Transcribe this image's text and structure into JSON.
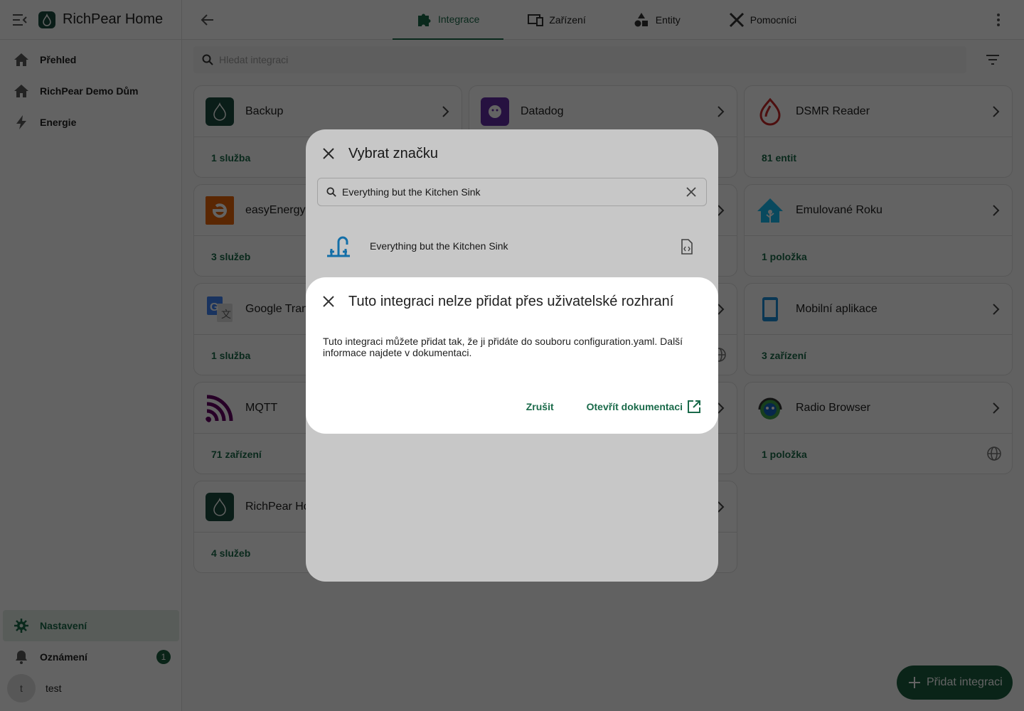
{
  "app": {
    "title": "RichPear Home"
  },
  "sidebar": {
    "items": [
      {
        "label": "Přehled",
        "icon": "home-icon"
      },
      {
        "label": "RichPear Demo Dům",
        "icon": "home-variant-icon"
      },
      {
        "label": "Energie",
        "icon": "lightning-bolt-icon"
      }
    ],
    "settings": {
      "label": "Nastavení",
      "icon": "gear-icon"
    },
    "notifications": {
      "label": "Oznámení",
      "badge": "1",
      "icon": "bell-icon"
    },
    "user": {
      "initial": "t",
      "name": "test"
    }
  },
  "tabs": [
    {
      "label": "Integrace",
      "icon": "puzzle-icon",
      "active": true
    },
    {
      "label": "Zařízení",
      "icon": "devices-icon"
    },
    {
      "label": "Entity",
      "icon": "shapes-icon"
    },
    {
      "label": "Pomocníci",
      "icon": "tools-icon"
    }
  ],
  "search": {
    "placeholder": "Hledat integraci"
  },
  "cards": [
    {
      "name": "Backup",
      "foot": "1 služba"
    },
    {
      "name": "Datadog",
      "foot": ""
    },
    {
      "name": "DSMR Reader",
      "foot": "81 entit"
    },
    {
      "name": "easyEnergy",
      "foot": "3 služeb"
    },
    {
      "name": "Emulované Roku",
      "foot": "1 položka"
    },
    {
      "name": "Google Translate",
      "foot": "1 služba"
    },
    {
      "name": "Mobilní aplikace",
      "foot": "3 zařízení"
    },
    {
      "name": "MQTT",
      "foot": "71 zařízení"
    },
    {
      "name": "Radio Browser",
      "foot": "1 položka"
    },
    {
      "name": "RichPear Home",
      "foot": "4 služeb"
    }
  ],
  "fab": {
    "label": "Přidat integraci"
  },
  "brand_dialog": {
    "title": "Vybrat značku",
    "search_value": "Everything but the Kitchen Sink",
    "result": "Everything but the Kitchen Sink"
  },
  "alert_dialog": {
    "title": "Tuto integraci nelze přidat přes uživatelské rozhraní",
    "body": "Tuto integraci můžete přidat tak, že ji přidáte do souboru configuration.yaml. Další informace najdete v dokumentaci.",
    "cancel": "Zrušit",
    "open_docs": "Otevřít dokumentaci"
  },
  "colors": {
    "accent": "#1a6a4a",
    "fab": "#1b5e3f",
    "scrim": "rgba(0,0,0,0.5)"
  }
}
